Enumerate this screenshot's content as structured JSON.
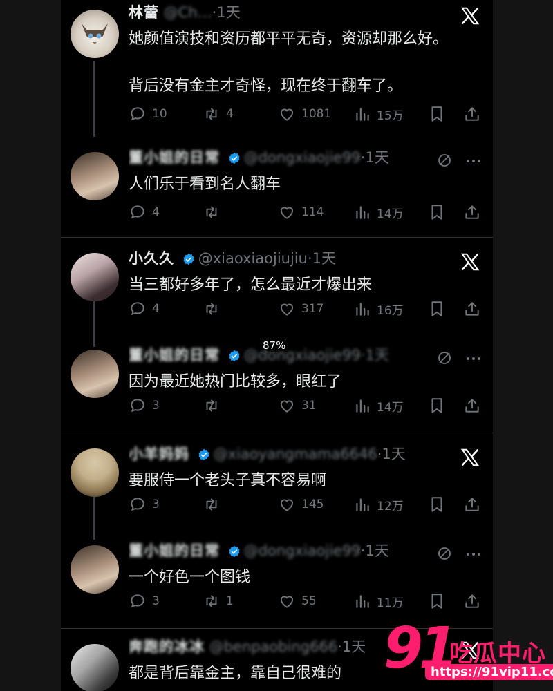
{
  "overlay": {
    "zoom_label": "87%"
  },
  "threads": [
    {
      "posts": [
        {
          "name": "林蕾",
          "handle": "@Ch…",
          "time": "·1天",
          "text": "她颜值演技和资历都平平无奇，资源却那么好。\n\n背后没有金主才奇怪，现在终于翻车了。",
          "replies": "10",
          "reposts": "4",
          "likes": "1081",
          "views": "15万"
        },
        {
          "name": "董小姐的日常",
          "handle": "@dongxiaojie99",
          "time": "·1天",
          "text": "人们乐于看到名人翻车",
          "replies": "4",
          "reposts": "",
          "likes": "114",
          "views": "14万"
        }
      ]
    },
    {
      "posts": [
        {
          "name": "小久久",
          "handle": "@xiaoxiaojiujiu",
          "time": "·1天",
          "text": "当三都好多年了，怎么最近才爆出来",
          "replies": "4",
          "reposts": "",
          "likes": "317",
          "views": "16万"
        },
        {
          "name": "董小姐的日常",
          "handle": "@dongxiaojie99",
          "time": "·1天",
          "text": "因为最近她热门比较多，眼红了",
          "replies": "3",
          "reposts": "",
          "likes": "31",
          "views": "14万"
        }
      ]
    },
    {
      "posts": [
        {
          "name": "小羊妈妈",
          "handle": "@xiaoyangmama6646",
          "time": "·1天",
          "text": "要服侍一个老头子真不容易啊",
          "replies": "3",
          "reposts": "",
          "likes": "145",
          "views": "12万"
        },
        {
          "name": "董小姐的日常",
          "handle": "@dongxiaojie99",
          "time": "·1天",
          "text": "一个好色一个图钱",
          "replies": "3",
          "reposts": "1",
          "likes": "55",
          "views": "11万"
        }
      ]
    },
    {
      "posts": [
        {
          "name": "奔跑的冰冰",
          "handle": "@benpaobing666",
          "time": "·1天",
          "text": "都是背后靠金主，靠自己很难的"
        }
      ]
    }
  ],
  "watermark": {
    "number": "91",
    "site_name": "吃瓜中心",
    "url": "https://91vip11.com"
  },
  "colors": {
    "background": "#000000",
    "text": "#e7e9ea",
    "muted": "#71767b",
    "verified": "#1d9bf0",
    "watermark": "#ff1d6e"
  }
}
